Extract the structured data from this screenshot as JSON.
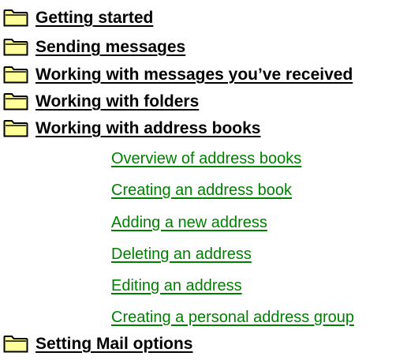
{
  "topics": [
    {
      "label": "Getting started",
      "icon": "folder-icon"
    },
    {
      "label": "Sending messages",
      "icon": "folder-icon"
    },
    {
      "label": "Working with messages you’ve received",
      "icon": "folder-icon"
    },
    {
      "label": "Working with folders",
      "icon": "folder-icon"
    },
    {
      "label": "Working with address books",
      "icon": "folder-icon",
      "open": true
    },
    {
      "label": "Setting Mail options",
      "icon": "folder-icon"
    }
  ],
  "subtopics": [
    {
      "label": "Overview of address books"
    },
    {
      "label": "Creating an address book"
    },
    {
      "label": "Adding a new address"
    },
    {
      "label": "Deleting an address"
    },
    {
      "label": "Editing an address"
    },
    {
      "label": "Creating a personal address group"
    }
  ],
  "colors": {
    "topic_text": "#000000",
    "link_text": "#008000",
    "folder_fill": "#ffff99",
    "folder_outline": "#000000"
  }
}
